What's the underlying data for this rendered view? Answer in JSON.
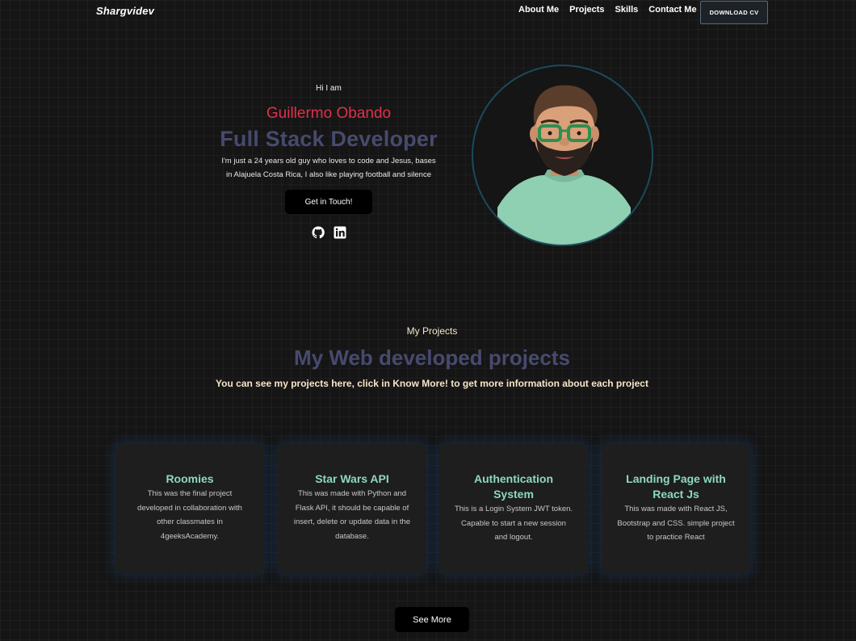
{
  "navbar": {
    "brand": "Shargvidev",
    "links": [
      "About Me",
      "Projects",
      "Skills",
      "Contact Me"
    ],
    "download_label": "DOWNLOAD CV"
  },
  "hero": {
    "greeting": "Hi I am",
    "name": "Guillermo Obando",
    "role": "Full Stack Developer",
    "bio": "I'm just a 24 years old guy who loves to code and Jesus, bases in Alajuela Costa Rica, I also like playing football and silence",
    "cta_label": "Get in Touch!",
    "social_icons": [
      "github-icon",
      "linkedin-icon"
    ]
  },
  "projects": {
    "eyebrow": "My Projects",
    "title": "My Web developed projects",
    "subtitle": "You can see my projects here, click in Know More! to get more information about each project",
    "cards": [
      {
        "title": "Roomies",
        "description": "This was the final project developed in collaboration with other classmates in 4geeksAcademy."
      },
      {
        "title": "Star Wars API",
        "description": "This was made with Python and Flask API, it should be capable of insert, delete or update data in the database."
      },
      {
        "title": "Authentication System",
        "description": "This is a Login System JWT token. Capable to start a new session and logout."
      },
      {
        "title": "Landing Page with React Js",
        "description": "This was made with React JS, Bootstrap and CSS. simple project to practice React"
      }
    ],
    "see_more_label": "See More"
  },
  "colors": {
    "background": "#151515",
    "name_accent": "#e0304a",
    "heading_muted": "#474a6e",
    "cream_text": "#f6e6c8",
    "card_title": "#8ed8c0",
    "card_glow": "#1e508c"
  }
}
